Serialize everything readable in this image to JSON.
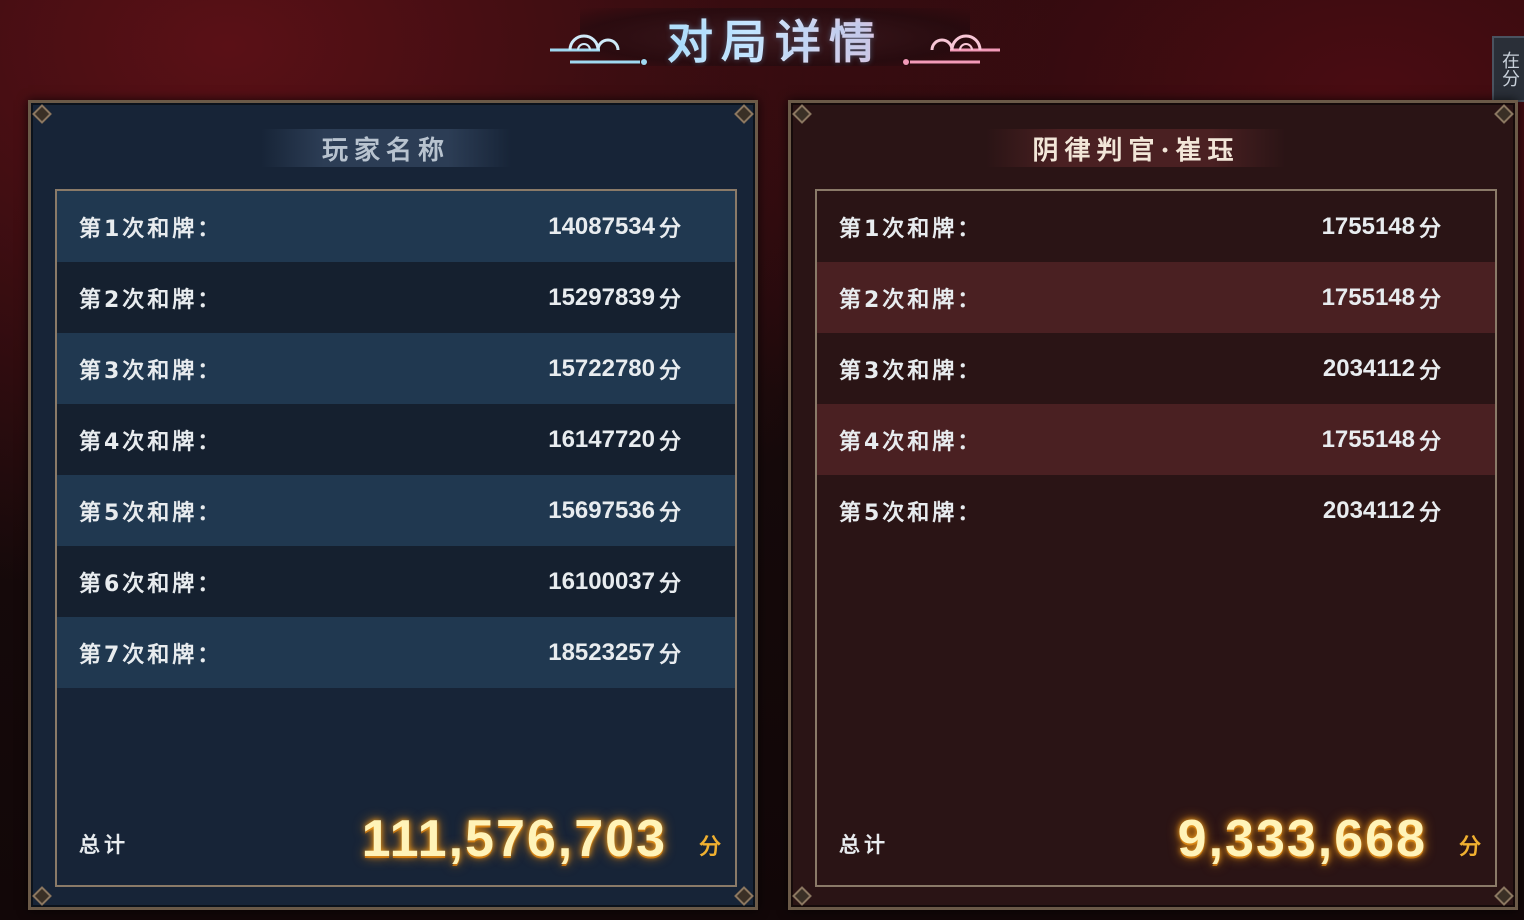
{
  "header": {
    "title": "对局详情"
  },
  "side_tab": {
    "text": "在分"
  },
  "panels": {
    "left": {
      "player_name": "玩家名称",
      "rows": [
        {
          "label": "第1次和牌：",
          "value": "14087534",
          "unit": "分"
        },
        {
          "label": "第2次和牌：",
          "value": "15297839",
          "unit": "分"
        },
        {
          "label": "第3次和牌：",
          "value": "15722780",
          "unit": "分"
        },
        {
          "label": "第4次和牌：",
          "value": "16147720",
          "unit": "分"
        },
        {
          "label": "第5次和牌：",
          "value": "15697536",
          "unit": "分"
        },
        {
          "label": "第6次和牌：",
          "value": "16100037",
          "unit": "分"
        },
        {
          "label": "第7次和牌：",
          "value": "18523257",
          "unit": "分"
        }
      ],
      "total_label": "总计",
      "total_value": "111,576,703",
      "total_unit": "分"
    },
    "right": {
      "player_name": "阴律判官·崔珏",
      "rows": [
        {
          "label": "第1次和牌：",
          "value": "1755148",
          "unit": "分"
        },
        {
          "label": "第2次和牌：",
          "value": "1755148",
          "unit": "分"
        },
        {
          "label": "第3次和牌：",
          "value": "2034112",
          "unit": "分"
        },
        {
          "label": "第4次和牌：",
          "value": "1755148",
          "unit": "分"
        },
        {
          "label": "第5次和牌：",
          "value": "2034112",
          "unit": "分"
        }
      ],
      "total_label": "总计",
      "total_value": "9,333,668",
      "total_unit": "分"
    }
  },
  "colors": {
    "left_panel_bg": "#172437",
    "right_panel_bg": "#2a1415",
    "total_glow": "#f0a020"
  }
}
